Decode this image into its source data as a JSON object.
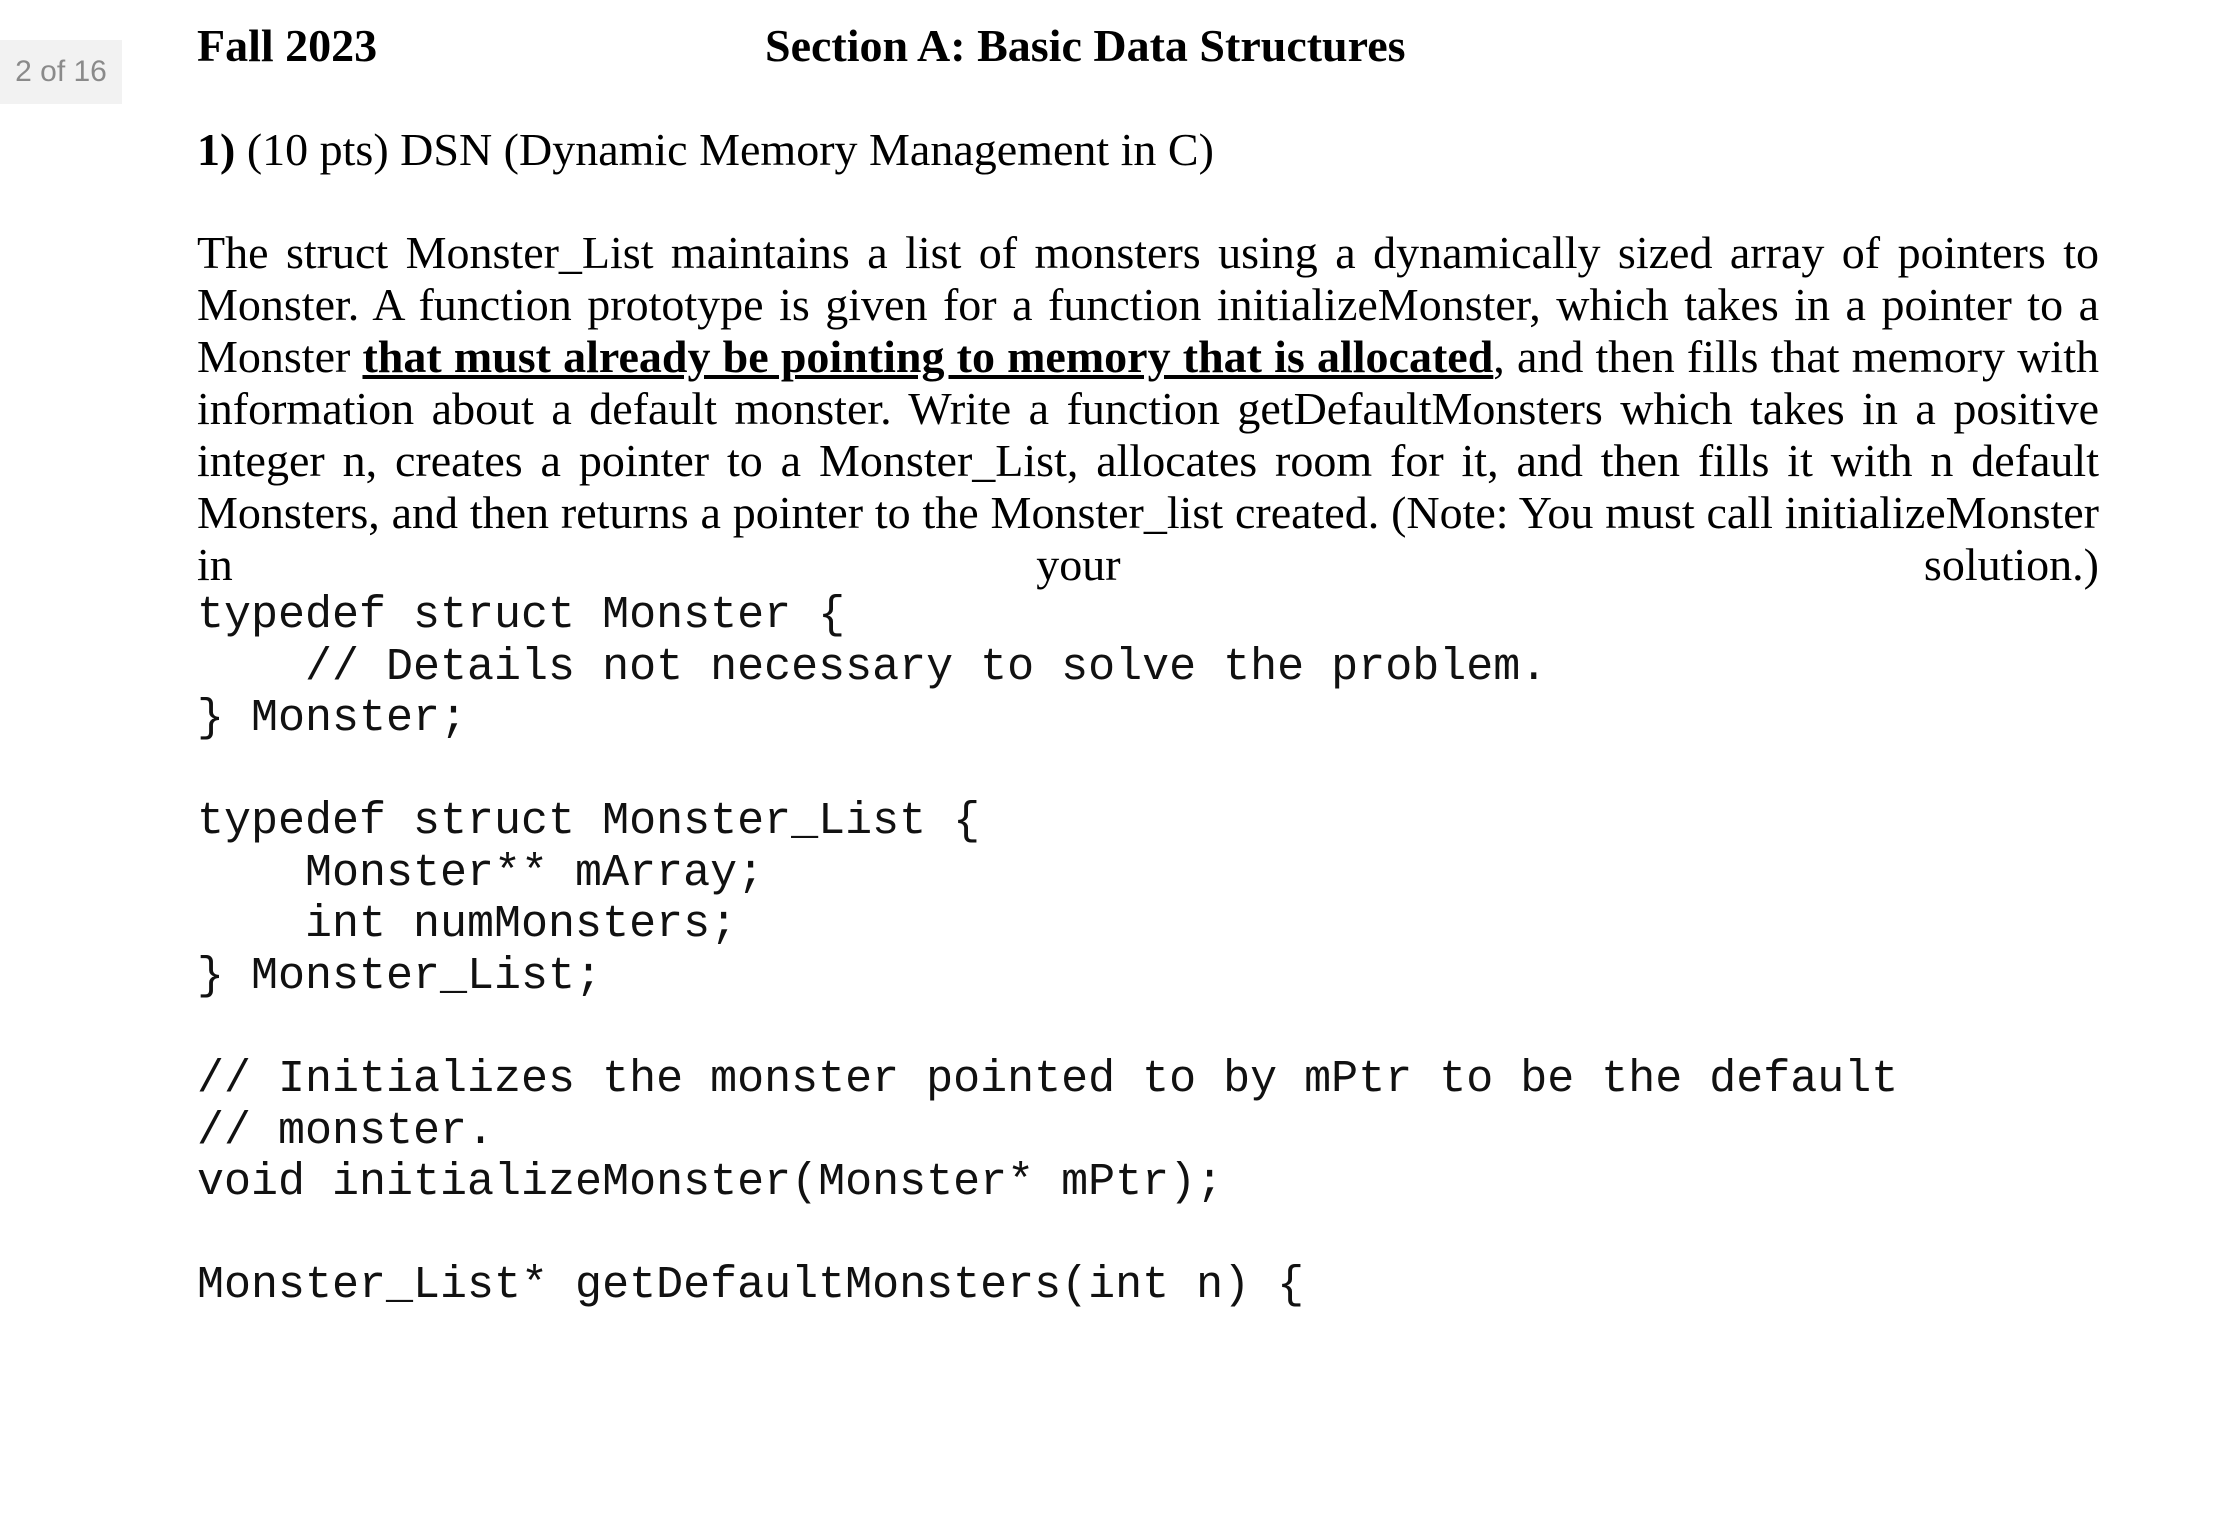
{
  "viewer": {
    "page_indicator": "2 of 16"
  },
  "header": {
    "term": "Fall 2023",
    "section": "Section A: Basic Data Structures"
  },
  "question": {
    "number": "1)",
    "title": "(10 pts) DSN (Dynamic Memory Management in C)",
    "prompt_part1": "The struct Monster_List maintains a list of monsters using a dynamically sized array of pointers to Monster. A function prototype is given for a function initializeMonster, which takes in a pointer to a Monster ",
    "prompt_emphasis": "that must already be pointing to memory that is allocated",
    "prompt_part2": ", and then fills that memory with information about a default monster. Write a function getDefaultMonsters which takes in a positive integer n, creates a pointer to a Monster_List, allocates room for it, and then fills it with n default Monsters, and then returns a pointer to the Monster_list created. (Note: You must call initializeMonster in your solution.)"
  },
  "code": {
    "block1": "typedef struct Monster {\n    // Details not necessary to solve the problem.\n} Monster;",
    "block2": "typedef struct Monster_List {\n    Monster** mArray;\n    int numMonsters;\n} Monster_List;",
    "block3": "// Initializes the monster pointed to by mPtr to be the default\n// monster.\nvoid initializeMonster(Monster* mPtr);",
    "block4": "Monster_List* getDefaultMonsters(int n) {"
  }
}
